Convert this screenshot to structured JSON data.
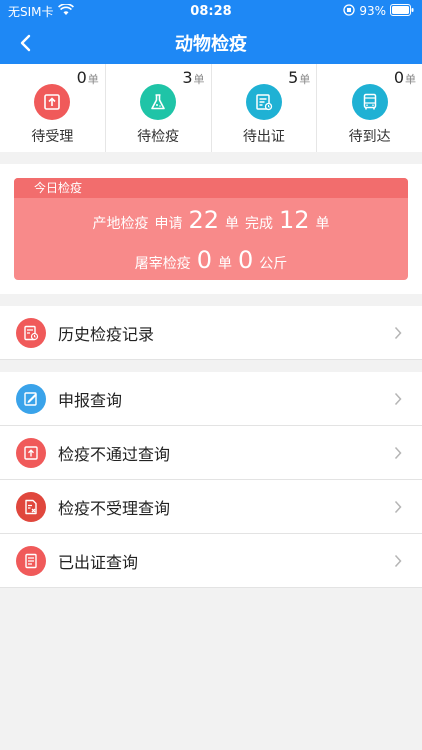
{
  "status": {
    "carrier": "无SIM卡",
    "time": "08:28",
    "battery": "93%"
  },
  "nav": {
    "title": "动物检疫"
  },
  "stats": [
    {
      "count": "0",
      "unit": "单",
      "label": "待受理",
      "color": "#f05a5a",
      "icon": "upload-doc-icon"
    },
    {
      "count": "3",
      "unit": "单",
      "label": "待检疫",
      "color": "#1fc4a7",
      "icon": "flask-icon"
    },
    {
      "count": "5",
      "unit": "单",
      "label": "待出证",
      "color": "#1fb1d4",
      "icon": "certificate-icon"
    },
    {
      "count": "0",
      "unit": "单",
      "label": "待到达",
      "color": "#1fb1d4",
      "icon": "bus-icon"
    }
  ],
  "today": {
    "title": "今日检疫",
    "origin_label": "产地检疫",
    "apply_label": "申请",
    "apply_count": "22",
    "unit": "单",
    "done_label": "完成",
    "done_count": "12",
    "slaughter_label": "屠宰检疫",
    "slaughter_count": "0",
    "weight": "0",
    "weight_unit": "公斤"
  },
  "menu_history": {
    "label": "历史检疫记录",
    "color": "#f05a5a",
    "icon": "history-record-icon"
  },
  "menu": [
    {
      "label": "申报查询",
      "color": "#3aa3ea",
      "icon": "declare-icon"
    },
    {
      "label": "检疫不通过查询",
      "color": "#f05a5a",
      "icon": "upload-doc-icon"
    },
    {
      "label": "检疫不受理查询",
      "color": "#e0473d",
      "icon": "reject-doc-icon"
    },
    {
      "label": "已出证查询",
      "color": "#f05a5a",
      "icon": "certificate-doc-icon"
    }
  ]
}
